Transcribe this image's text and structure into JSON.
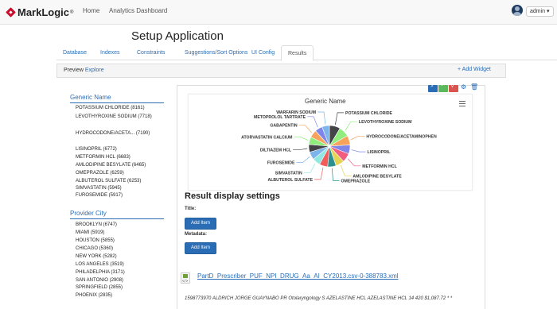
{
  "navbar": {
    "brand": "MarkLogic",
    "brand_tm": "®",
    "links": [
      "Home",
      "Analytics Dashboard"
    ],
    "user": "admin ▾"
  },
  "page_title": "Setup Application",
  "tabs": [
    "Database",
    "Indexes",
    "Constraints",
    "Suggestions/Sort Options",
    "UI Config",
    "Results"
  ],
  "active_tab": "Results",
  "preview": {
    "label": "Preview",
    "link": "Explore"
  },
  "add_widget": "+ Add Widget",
  "widget_controls": {
    "colors": [
      "#2a6db5",
      "#5cb85c",
      "#d9534f"
    ],
    "glyphs": [
      ">",
      "^",
      "v"
    ],
    "gear": "⚙",
    "trash": "🗑"
  },
  "facets": [
    {
      "title": "Generic Name",
      "items": [
        "POTASSIUM CHLORIDE (8161)",
        "LEVOTHYROXINE SODIUM (7718)",
        "HYDROCODONE/ACETA... (7190)",
        "LISINOPRIL (6772)",
        "METFORMIN HCL (6683)",
        "AMLODIPINE BESYLATE (6465)",
        "OMEPRAZOLE (6259)",
        "ALBUTEROL SULFATE (6253)",
        "SIMVASTATIN (5945)",
        "FUROSEMIDE (5917)"
      ]
    },
    {
      "title": "Provider City",
      "items": [
        "BROOKLYN (6747)",
        "MIAMI (5919)",
        "HOUSTON (5855)",
        "CHICAGO (5360)",
        "NEW YORK (5282)",
        "LOS ANGELES (3519)",
        "PHILADELPHIA (3171)",
        "SAN ANTONIO (2908)",
        "SPRINGFIELD (2855)",
        "PHOENIX (2835)"
      ]
    }
  ],
  "chart_data": {
    "type": "pie",
    "title": "Generic Name",
    "slices": [
      {
        "name": "POTASSIUM CHLORIDE",
        "value": 8161,
        "color": "#434348"
      },
      {
        "name": "LEVOTHYROXINE SODIUM",
        "value": 7718,
        "color": "#90ed7d"
      },
      {
        "name": "HYDROCODONE/ACETAMINOPHEN",
        "value": 7190,
        "color": "#f7a35c"
      },
      {
        "name": "LISINOPRIL",
        "value": 6772,
        "color": "#8085e9"
      },
      {
        "name": "METFORMIN HCL",
        "value": 6683,
        "color": "#f15c80"
      },
      {
        "name": "AMLODIPINE BESYLATE",
        "value": 6465,
        "color": "#e4d354"
      },
      {
        "name": "OMEPRAZOLE",
        "value": 6259,
        "color": "#2b908f"
      },
      {
        "name": "ALBUTEROL SULFATE",
        "value": 6253,
        "color": "#f45b5b"
      },
      {
        "name": "SIMVASTATIN",
        "value": 5945,
        "color": "#91e8e1"
      },
      {
        "name": "FUROSEMIDE",
        "value": 5917,
        "color": "#7cb5ec"
      },
      {
        "name": "DILTIAZEM HCL",
        "value": 5800,
        "color": "#434348"
      },
      {
        "name": "ATORVASTATIN CALCIUM",
        "value": 5750,
        "color": "#90ed7d"
      },
      {
        "name": "GABAPENTIN",
        "value": 5700,
        "color": "#f7a35c"
      },
      {
        "name": "METOPROLOL TARTRATE",
        "value": 5650,
        "color": "#8085e9"
      },
      {
        "name": "WARFARIN SODIUM",
        "value": 5600,
        "color": "#7cb5ec"
      }
    ]
  },
  "result_settings": {
    "title": "Result display settings",
    "title_label": "Title:",
    "metadata_label": "Metadata:",
    "add_item": "Add Item"
  },
  "result": {
    "link": "PartD_Prescriber_PUF_NPI_DRUG_Aa_AI_CY2013.csv-0-388783.xml",
    "icon_text": "</>",
    "snippet": "1598773970 ALDRICH JORGE GUAYNABO PR Otolaryngology S AZELASTINE HCL AZELASTINE HCL 14 420 $1,087.72 * *"
  }
}
